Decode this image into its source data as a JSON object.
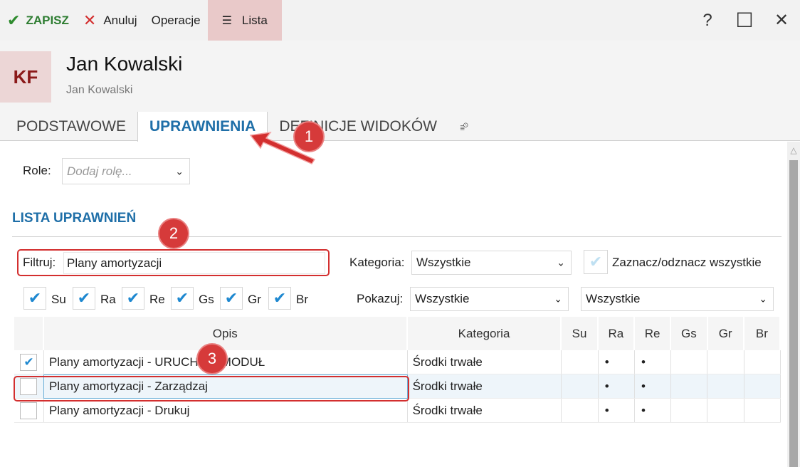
{
  "toolbar": {
    "save_label": "ZAPISZ",
    "cancel_label": "Anuluj",
    "operations_label": "Operacje",
    "list_label": "Lista",
    "help_glyph": "?",
    "maximize_glyph": "☐",
    "close_glyph": "✕"
  },
  "header": {
    "avatar_initials": "KF",
    "title": "Jan Kowalski",
    "subtitle": "Jan Kowalski"
  },
  "tabs": [
    {
      "label": "PODSTAWOWE",
      "active": false
    },
    {
      "label": "UPRAWNIENIA",
      "active": true
    },
    {
      "label": "DEFINICJE WIDOKÓW",
      "active": false
    }
  ],
  "roles": {
    "label": "Role:",
    "placeholder": "Dodaj rolę..."
  },
  "section_title": "LISTA UPRAWNIEŃ",
  "filter": {
    "label": "Filtruj:",
    "value": "Plany amortyzacji"
  },
  "category": {
    "label": "Kategoria:",
    "value": "Wszystkie"
  },
  "select_all_label": "Zaznacz/odznacz wszystkie",
  "flags": [
    {
      "label": "Su",
      "checked": true
    },
    {
      "label": "Ra",
      "checked": true
    },
    {
      "label": "Re",
      "checked": true
    },
    {
      "label": "Gs",
      "checked": true
    },
    {
      "label": "Gr",
      "checked": true
    },
    {
      "label": "Br",
      "checked": true
    }
  ],
  "show": {
    "label": "Pokazuj:",
    "value1": "Wszystkie",
    "value2": "Wszystkie"
  },
  "grid": {
    "columns": [
      "Opis",
      "Kategoria",
      "Su",
      "Ra",
      "Re",
      "Gs",
      "Gr",
      "Br"
    ],
    "rows": [
      {
        "checked": true,
        "opis": "Plany amortyzacji - URUCHOM MODUŁ",
        "kategoria": "Środki trwałe",
        "su": "",
        "ra": "•",
        "re": "•",
        "gs": "",
        "gr": "",
        "br": ""
      },
      {
        "checked": false,
        "opis": "Plany amortyzacji - Zarządzaj",
        "kategoria": "Środki trwałe",
        "su": "",
        "ra": "•",
        "re": "•",
        "gs": "",
        "gr": "",
        "br": ""
      },
      {
        "checked": false,
        "opis": "Plany amortyzacji - Drukuj",
        "kategoria": "Środki trwałe",
        "su": "",
        "ra": "•",
        "re": "•",
        "gs": "",
        "gr": "",
        "br": ""
      }
    ]
  },
  "annotations": [
    "1",
    "2",
    "3"
  ],
  "colors": {
    "accent": "#1f6fa8",
    "save": "#2e7d32",
    "cancel": "#d32f2f",
    "annotation": "#d32f2f",
    "check": "#1e88d0"
  }
}
